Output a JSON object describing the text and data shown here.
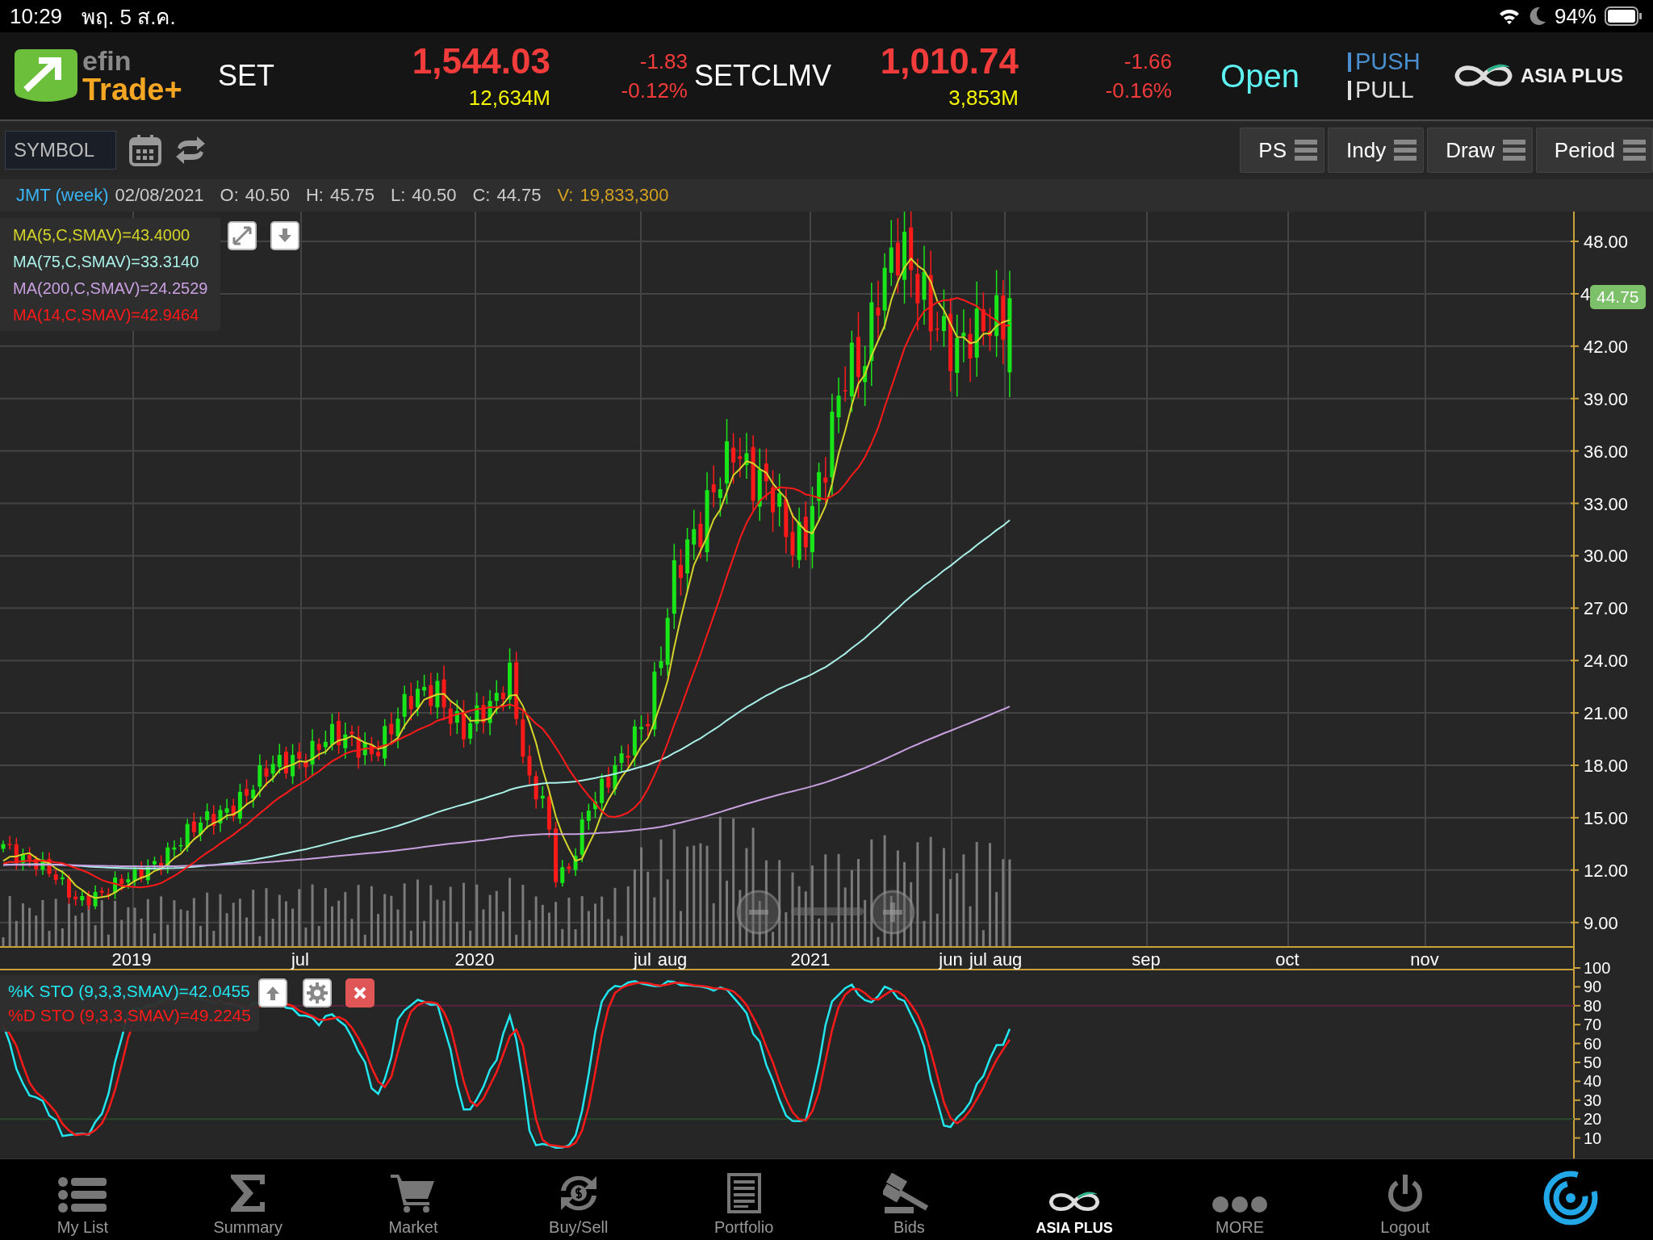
{
  "status_bar": {
    "time": "10:29",
    "date": "พฤ. 5 ส.ค.",
    "battery": "94%"
  },
  "header": {
    "logo": {
      "line_1": "efin",
      "line_2": "Trade+"
    },
    "indices": [
      {
        "name": "SET",
        "value": "1,544.03",
        "volume": "12,634M",
        "change": "-1.83",
        "percent": "-0.12%"
      },
      {
        "name": "SETCLMV",
        "value": "1,010.74",
        "volume": "3,853M",
        "change": "-1.66",
        "percent": "-0.16%"
      }
    ],
    "market_status": "Open",
    "modes": [
      {
        "label": "PUSH",
        "selected": true
      },
      {
        "label": "PULL",
        "selected": false
      }
    ],
    "broker_logo": "ASIA PLUS"
  },
  "toolbar": {
    "symbol_field": {
      "placeholder": "SYMBOL"
    },
    "buttons": [
      "PS",
      "Indy",
      "Draw",
      "Period"
    ]
  },
  "quote_line": {
    "symbol": "JMT (week)",
    "date": "02/08/2021",
    "fields": [
      {
        "label": "O:",
        "value": "40.50",
        "kind": "price"
      },
      {
        "label": "H:",
        "value": "45.75",
        "kind": "price"
      },
      {
        "label": "L:",
        "value": "40.50",
        "kind": "price"
      },
      {
        "label": "C:",
        "value": "44.75",
        "kind": "price"
      },
      {
        "label": "V:",
        "value": "19,833,300",
        "kind": "volume"
      }
    ]
  },
  "chart": {
    "legend": [
      {
        "text": "MA(5,C,SMAV)=43.4000",
        "color": "#d4d42a"
      },
      {
        "text": "MA(75,C,SMAV)=33.3140",
        "color": "#a8f0e8"
      },
      {
        "text": "MA(200,C,SMAV)=24.2529",
        "color": "#c8a0e0"
      },
      {
        "text": "MA(14,C,SMAV)=42.9464",
        "color": "#ff1a1a"
      }
    ],
    "price_labels": [
      "48.00",
      "4",
      "42.00",
      "39.00",
      "36.00",
      "33.00",
      "30.00",
      "27.00",
      "24.00",
      "21.00",
      "18.00",
      "15.00",
      "12.00",
      "9.00"
    ],
    "last_price": "44.75",
    "date_labels": [
      "2019",
      "jul",
      "2020",
      "jul",
      "aug",
      "2021",
      "jun",
      "jul",
      "aug",
      "sep",
      "oct",
      "nov"
    ],
    "stochastic": {
      "legend": [
        {
          "text": "%K STO (9,3,3,SMAV)=42.0455",
          "color": "#22e6f0"
        },
        {
          "text": "%D STO (9,3,3,SMAV)=49.2245",
          "color": "#ff1a1a"
        }
      ],
      "labels": [
        "100",
        "90",
        "80",
        "70",
        "60",
        "50",
        "40",
        "30",
        "20",
        "10"
      ]
    }
  },
  "tab_bar": {
    "tabs": [
      {
        "label": "My List",
        "kind": "tab"
      },
      {
        "label": "Summary",
        "kind": "tab"
      },
      {
        "label": "Market",
        "kind": "tab"
      },
      {
        "label": "Buy/Sell",
        "kind": "tab"
      },
      {
        "label": "Portfolio",
        "kind": "tab"
      },
      {
        "label": "Bids",
        "kind": "tab"
      },
      {
        "label": "ASIA PLUS",
        "kind": "logo"
      },
      {
        "label": "MORE",
        "kind": "tab"
      },
      {
        "label": "Logout",
        "kind": "tab"
      },
      {
        "kind": "app"
      }
    ]
  }
}
